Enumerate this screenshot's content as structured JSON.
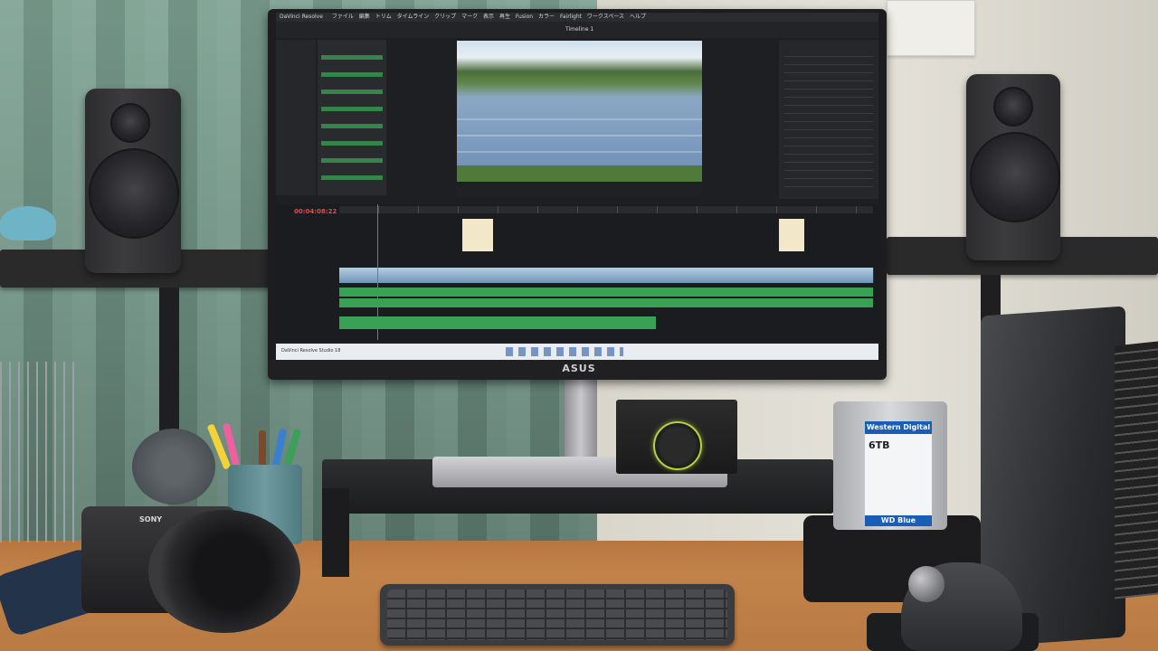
{
  "scene": {
    "description_tags": [
      "desk-setup",
      "monitor",
      "video-editor"
    ]
  },
  "monitor": {
    "brand": "ASUS",
    "app": {
      "title_bar": "DaVinci Resolve",
      "menu": [
        "ファイル",
        "編集",
        "トリム",
        "タイムライン",
        "クリップ",
        "マーク",
        "表示",
        "再生",
        "Fusion",
        "カラー",
        "Fairlight",
        "ワークスペース",
        "ヘルプ"
      ],
      "timeline_name": "Timeline 1",
      "timecode": "00:04:08:22",
      "taskbar_title": "DaVinci Resolve Studio 18"
    }
  },
  "hdd": {
    "brand": "Western Digital",
    "capacity": "6TB",
    "series": "WD Blue"
  },
  "camera": {
    "brand": "SONY"
  }
}
